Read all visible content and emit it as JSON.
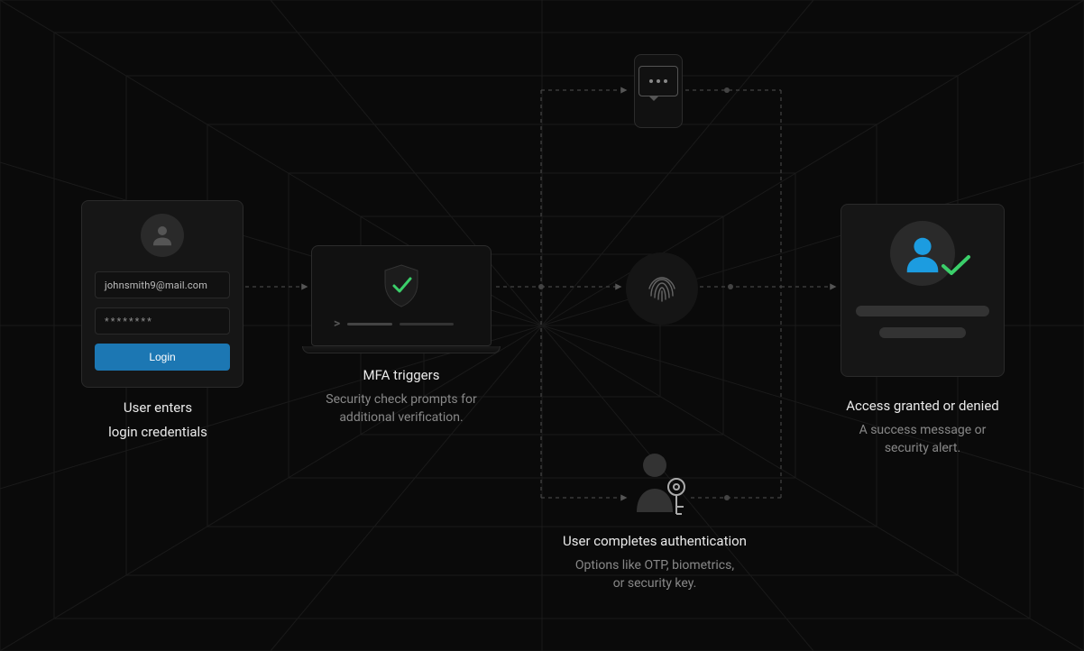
{
  "steps": {
    "login": {
      "title_line1": "User enters",
      "title_line2": "login credentials",
      "email": "johnsmith9@mail.com",
      "password_mask": "********",
      "button": "Login"
    },
    "mfa": {
      "title": "MFA triggers",
      "desc_line1": "Security check prompts for",
      "desc_line2": "additional verification."
    },
    "auth": {
      "title": "User completes authentication",
      "desc_line1": "Options like OTP, biometrics,",
      "desc_line2": "or security key."
    },
    "result": {
      "title": "Access granted or denied",
      "desc_line1": "A success message or",
      "desc_line2": "security alert."
    }
  },
  "colors": {
    "accent_green": "#3bcf6a",
    "accent_blue": "#1c9ce0"
  }
}
